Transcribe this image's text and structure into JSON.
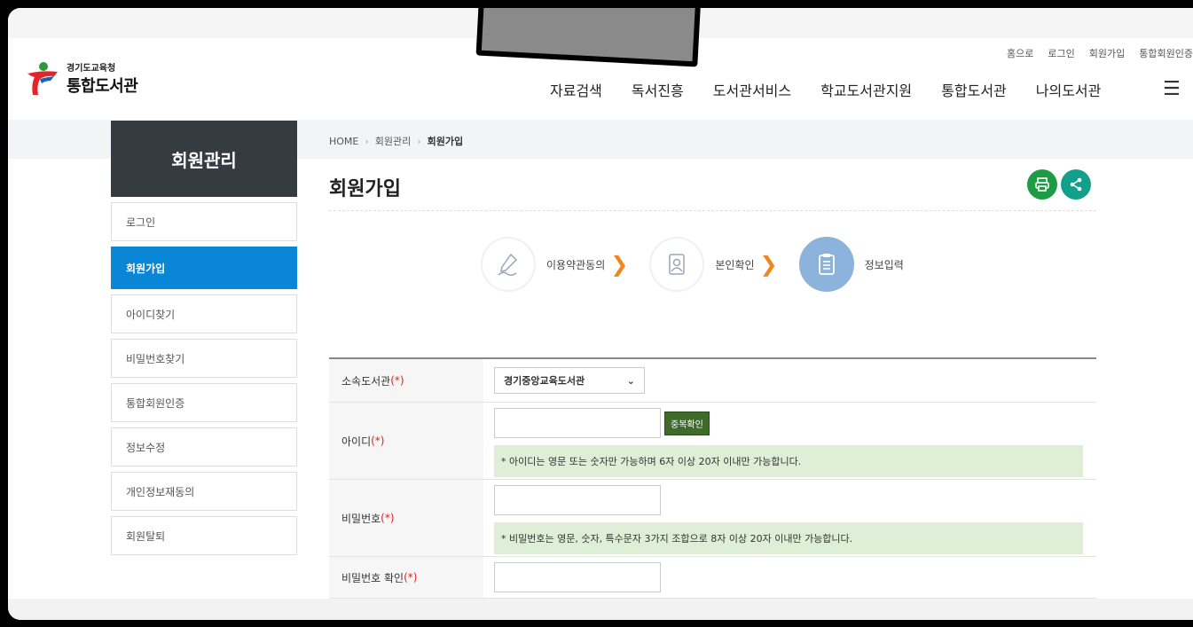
{
  "header": {
    "logo_sub": "경기도교육청",
    "logo_main": "통합도서관",
    "util_links": [
      "홈으로",
      "로그인",
      "회원가입",
      "통합회원인증"
    ],
    "nav": [
      "자료검색",
      "독서진흥",
      "도서관서비스",
      "학교도서관지원",
      "통합도서관",
      "나의도서관"
    ]
  },
  "sidebar": {
    "title": "회원관리",
    "items": [
      {
        "label": "로그인",
        "active": false
      },
      {
        "label": "회원가입",
        "active": true
      },
      {
        "label": "아이디찾기",
        "active": false
      },
      {
        "label": "비밀번호찾기",
        "active": false
      },
      {
        "label": "통합회원인증",
        "active": false
      },
      {
        "label": "정보수정",
        "active": false
      },
      {
        "label": "개인정보재동의",
        "active": false
      },
      {
        "label": "회원탈퇴",
        "active": false
      }
    ]
  },
  "breadcrumb": {
    "home": "HOME",
    "level1": "회원관리",
    "current": "회원가입"
  },
  "page_title": "회원가입",
  "steps": [
    {
      "label": "이용약관동의",
      "icon": "pen-sign-icon"
    },
    {
      "label": "본인확인",
      "icon": "id-card-icon"
    },
    {
      "label": "정보입력",
      "icon": "clipboard-icon",
      "current": true
    }
  ],
  "form": {
    "library_label": "소속도서관 ",
    "library_req": "(*)",
    "library_value": "경기중앙교육도서관",
    "id_label": "아이디",
    "id_req": "(*)",
    "dup_button": "중복확인",
    "id_hint": "* 아이디는 영문 또는 숫자만 가능하며 6자 이상 20자 이내만 가능합니다.",
    "pw_label": "비밀번호",
    "pw_req": "(*)",
    "pw_hint": "* 비밀번호는 영문, 숫자, 특수문자 3가지 조합으로 8자 이상 20자 이내만 가능합니다.",
    "pw_confirm_label": "비밀번호 확인",
    "pw_confirm_req": "(*)"
  },
  "colors": {
    "accent": "#0a86d6",
    "sidebar_head": "#363b42",
    "print": "#1e9b45",
    "share": "#12a08b",
    "step_arrow": "#f0871c"
  }
}
